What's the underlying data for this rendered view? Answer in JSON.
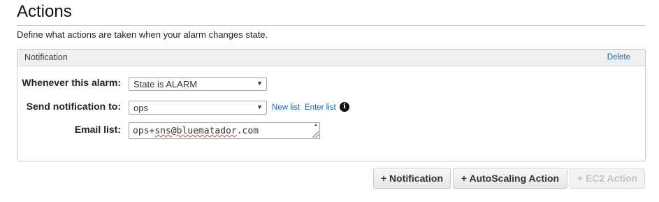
{
  "section": {
    "title": "Actions",
    "description": "Define what actions are taken when your alarm changes state."
  },
  "notification": {
    "panel_title": "Notification",
    "delete_label": "Delete",
    "whenever_label": "Whenever this alarm:",
    "whenever_value": "State is ALARM",
    "send_label": "Send notification to:",
    "send_value": "ops",
    "new_list_label": "New list",
    "enter_list_label": "Enter list",
    "email_label": "Email list:",
    "email_value_prefix": "ops+",
    "email_value_flagged": "sns@bluematador",
    "email_value_suffix": ".com"
  },
  "buttons": {
    "notification": "+ Notification",
    "autoscaling": "+ AutoScaling Action",
    "ec2": "+ EC2 Action"
  },
  "icons": {
    "info": "info-icon",
    "caret": "chevron-down-icon"
  }
}
